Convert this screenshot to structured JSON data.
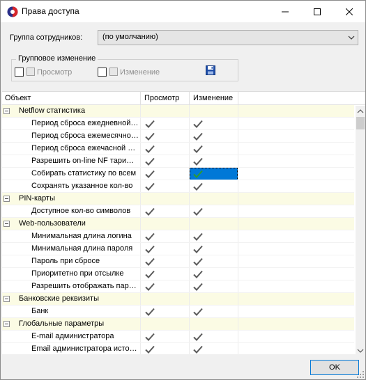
{
  "window": {
    "title": "Права доступа"
  },
  "controls": {
    "group_label": "Группа сотрудников:",
    "group_value": "(по умолчанию)",
    "group_change_legend": "Групповое изменение",
    "view_label": "Просмотр",
    "edit_label": "Изменение"
  },
  "grid": {
    "columns": [
      "Объект",
      "Просмотр",
      "Изменение"
    ],
    "rows": [
      {
        "type": "group",
        "label": "Netflow статистика"
      },
      {
        "type": "item",
        "label": "Период сброса ежедневной статистики",
        "view": true,
        "edit": true
      },
      {
        "type": "item",
        "label": "Период сброса ежемесячной статистики",
        "view": true,
        "edit": true
      },
      {
        "type": "item",
        "label": "Период сброса ежечасной статистики",
        "view": true,
        "edit": true
      },
      {
        "type": "item",
        "label": "Разрешить on-line NF тарифицирование",
        "view": true,
        "edit": true
      },
      {
        "type": "item",
        "label": "Собирать статистику по всем",
        "view": true,
        "edit": true,
        "selected": true
      },
      {
        "type": "item",
        "label": "Сохранять указанное кол-во",
        "view": true,
        "edit": true
      },
      {
        "type": "group",
        "label": "PIN-карты"
      },
      {
        "type": "item",
        "label": "Доступное кол-во символов",
        "view": true,
        "edit": true
      },
      {
        "type": "group",
        "label": "Web-пользователи"
      },
      {
        "type": "item",
        "label": "Минимальная длина логина",
        "view": true,
        "edit": true
      },
      {
        "type": "item",
        "label": "Минимальная длина пароля",
        "view": true,
        "edit": true
      },
      {
        "type": "item",
        "label": "Пароль при сбросе",
        "view": true,
        "edit": true
      },
      {
        "type": "item",
        "label": "Приоритетно при отсылке",
        "view": true,
        "edit": true
      },
      {
        "type": "item",
        "label": "Разрешить отображать пароль",
        "view": true,
        "edit": true
      },
      {
        "type": "group",
        "label": "Банковские реквизиты"
      },
      {
        "type": "item",
        "label": "Банк",
        "view": true,
        "edit": true
      },
      {
        "type": "group",
        "label": "Глобальные параметры"
      },
      {
        "type": "item",
        "label": "E-mail администратора",
        "view": true,
        "edit": true
      },
      {
        "type": "item",
        "label": "Email администратора историй",
        "view": true,
        "edit": true
      }
    ]
  },
  "footer": {
    "ok_label": "OK"
  },
  "colors": {
    "accent": "#0078d7",
    "group_row_bg": "#fbfbe4",
    "check_gray": "#5a5a5a",
    "check_green": "#2e9b2e"
  }
}
